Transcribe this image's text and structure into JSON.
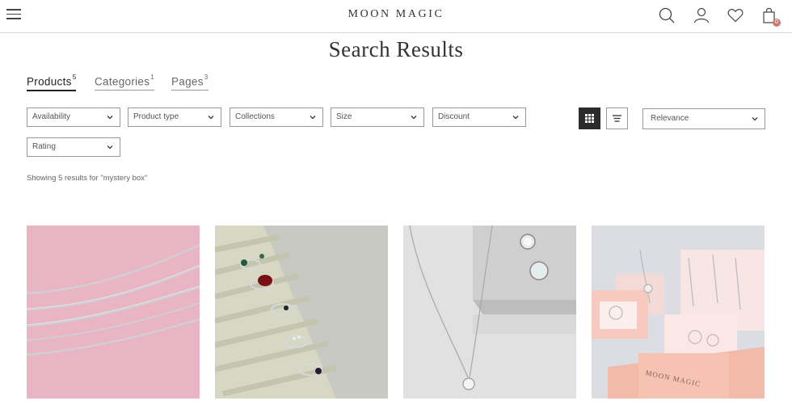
{
  "header": {
    "logo": "MOON MAGIC",
    "icons": [
      "menu-icon",
      "search-icon",
      "account-icon",
      "heart-icon",
      "cart-icon"
    ],
    "cart_count": "0"
  },
  "page": {
    "title": "Search Results"
  },
  "tabs": [
    {
      "label": "Products",
      "count": "5",
      "active": true
    },
    {
      "label": "Categories",
      "count": "1",
      "active": false
    },
    {
      "label": "Pages",
      "count": "3",
      "active": false
    }
  ],
  "filters": [
    {
      "label": "Availability"
    },
    {
      "label": "Product type"
    },
    {
      "label": "Collections"
    },
    {
      "label": "Size"
    },
    {
      "label": "Discount"
    },
    {
      "label": "Rating"
    }
  ],
  "view": {
    "options": [
      "grid-view-icon",
      "list-view-icon"
    ],
    "active": "grid"
  },
  "sort": {
    "label": "Relevance"
  },
  "results": {
    "text": "Showing 5 results for \"mystery box\""
  },
  "products": [
    {
      "image": "silver-chains-on-pink"
    },
    {
      "image": "rings-in-velvet-tray"
    },
    {
      "image": "pendant-and-stud-earrings"
    },
    {
      "image": "moon-magic-gift-boxes"
    }
  ],
  "colors": {
    "text": "#333333",
    "border": "#999999",
    "active_toggle": "#2b2b2b",
    "badge": "#c97d73"
  }
}
